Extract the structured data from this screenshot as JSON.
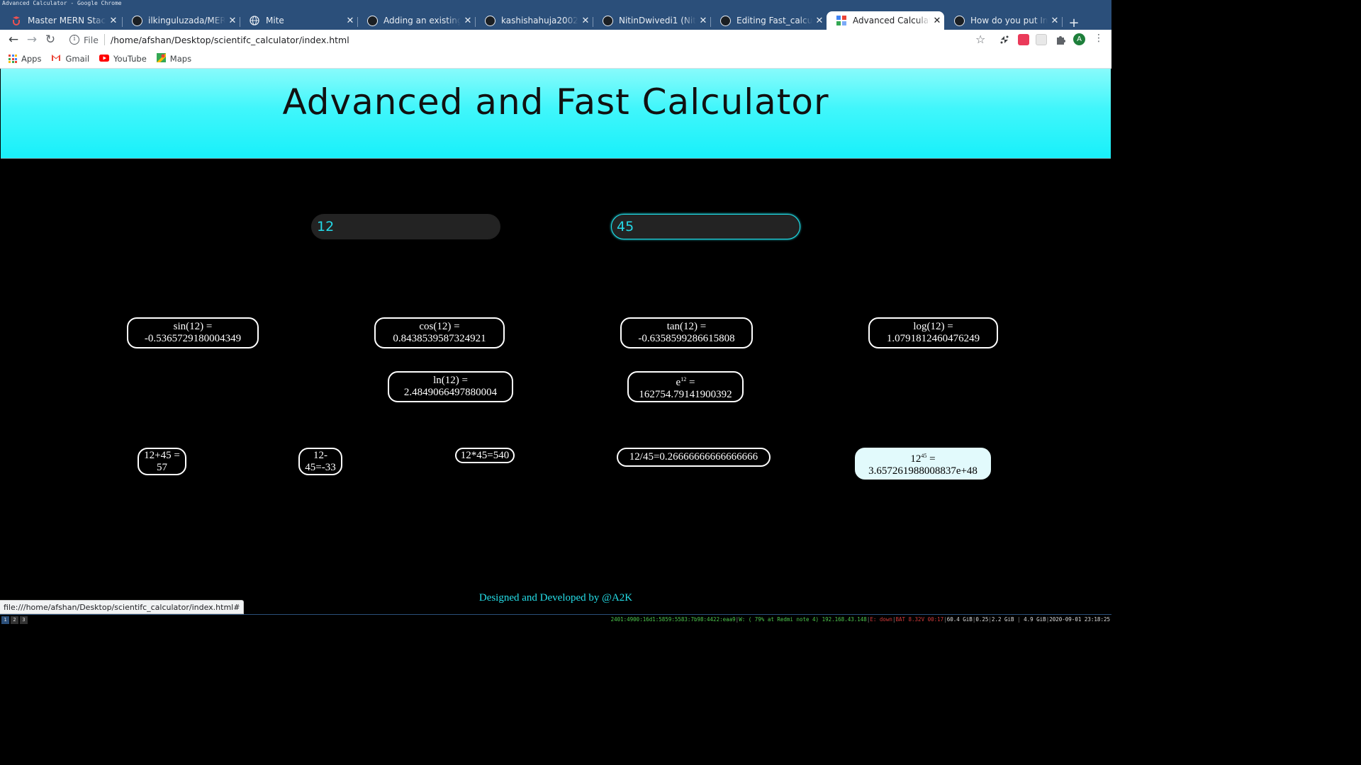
{
  "window_title": "Advanced Calculator - Google Chrome",
  "tabs": [
    {
      "label": "Master MERN Stack by",
      "icon": "udemy-icon"
    },
    {
      "label": "ilkinguluzada/MERNSta",
      "icon": "github-icon"
    },
    {
      "label": "Mite",
      "icon": "globe-icon"
    },
    {
      "label": "Adding an existing proj",
      "icon": "github-icon"
    },
    {
      "label": "kashishahuja2002 (Kash",
      "icon": "github-icon"
    },
    {
      "label": "NitinDwivedi1 (Nitin Dw",
      "icon": "github-icon"
    },
    {
      "label": "Editing Fast_calculator",
      "icon": "github-icon"
    },
    {
      "label": "Advanced Calculator",
      "icon": "calculator-favicon",
      "active": true
    },
    {
      "label": "How do you put Image",
      "icon": "github-icon"
    }
  ],
  "address": {
    "scheme": "File",
    "path": "/home/afshan/Desktop/scientifc_calculator/index.html"
  },
  "bookmarks": [
    {
      "label": "Apps",
      "icon": "apps-grid-icon"
    },
    {
      "label": "Gmail",
      "icon": "gmail-icon"
    },
    {
      "label": "YouTube",
      "icon": "youtube-icon"
    },
    {
      "label": "Maps",
      "icon": "maps-icon"
    }
  ],
  "profile_initial": "A",
  "page": {
    "title": "Advanced and Fast Calculator",
    "input1": "12",
    "input2": "45",
    "results": {
      "sin": {
        "l1": "sin(12) =",
        "l2": "-0.5365729180004349"
      },
      "cos": {
        "l1": "cos(12) =",
        "l2": "0.8438539587324921"
      },
      "tan": {
        "l1": "tan(12) =",
        "l2": "-0.6358599286615808"
      },
      "log": {
        "l1": "log(12) =",
        "l2": "1.0791812460476249"
      },
      "ln": {
        "l1": "ln(12) =",
        "l2": "2.4849066497880004"
      },
      "exp": {
        "base": "e",
        "sup": "12",
        "eq": " =",
        "l2": "162754.79141900392"
      },
      "add": {
        "l1": "12+45 =",
        "l2": "57"
      },
      "sub": {
        "l1": "12-",
        "l2": "45=-33"
      },
      "mul": {
        "l1": "12*45=540"
      },
      "div": {
        "l1": "12/45=0.26666666666666666"
      },
      "pow": {
        "base": "12",
        "sup": "45",
        "eq": " =",
        "l2": "3.657261988008837e+48"
      }
    },
    "footer": "Designed and Developed by @A2K"
  },
  "status_link": "file:///home/afshan/Desktop/scientifc_calculator/index.html#",
  "workspaces": [
    "1",
    "2",
    "3"
  ],
  "sysinfo": {
    "ip6": "2401:4900:16d1:5859:5583:7b98:4422:eaa9",
    "wifi": "W: ( 79% at Redmi note 4) 192.168.43.148",
    "eth": "E: down",
    "bat": "BAT 8.32V 00:17",
    "disk": "60.4 GiB",
    "load": "0.25",
    "mem": "2.2 GiB",
    "swap": "4.9 GiB",
    "datetime": "2020-09-01 23:18:25"
  },
  "colors": {
    "header_cyan": "#18f0fa",
    "accent_cyan": "#24d9e8",
    "chrome_frame": "#2b4f7a",
    "background": "#000000"
  }
}
